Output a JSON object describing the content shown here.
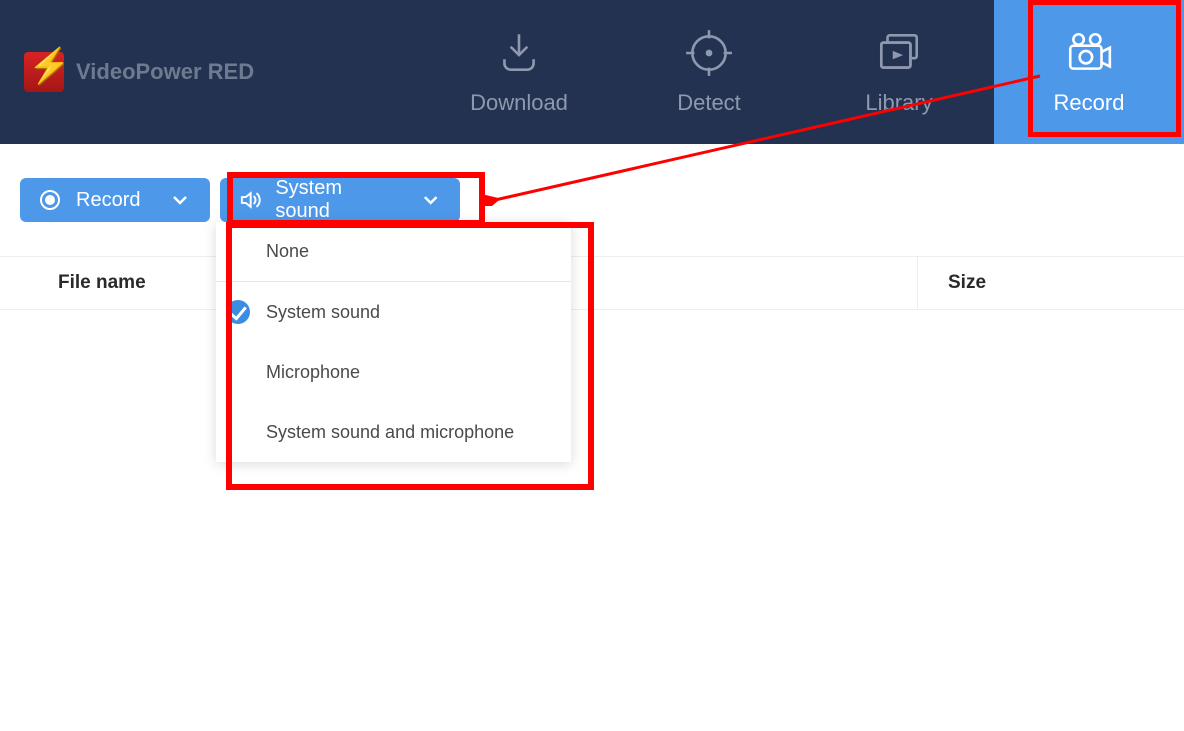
{
  "app": {
    "title": "VideoPower RED"
  },
  "nav": {
    "download": "Download",
    "detect": "Detect",
    "library": "Library",
    "record": "Record"
  },
  "toolbar": {
    "record_label": "Record",
    "sound_label": "System sound"
  },
  "sound_options": {
    "none": "None",
    "system": "System sound",
    "mic": "Microphone",
    "both": "System sound and microphone",
    "selected": "system"
  },
  "table": {
    "col_filename": "File name",
    "col_size": "Size"
  }
}
